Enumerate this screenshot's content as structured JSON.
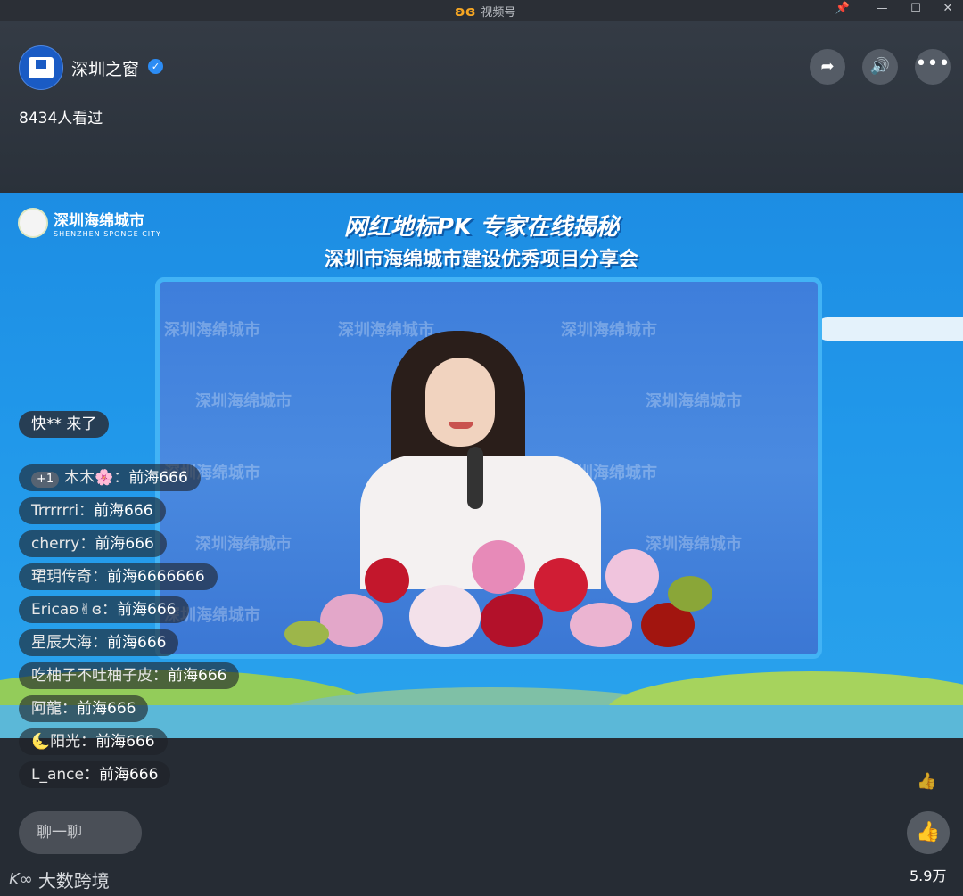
{
  "window": {
    "app_title": "视频号",
    "logo_icon": "butterfly-icon",
    "pin": "📌",
    "minimize": "—",
    "maximize": "☐",
    "close": "✕"
  },
  "channel": {
    "name": "深圳之窗",
    "viewers": "8434人看过"
  },
  "video": {
    "brand_name": "深圳海绵城市",
    "brand_sub": "SHENZHEN SPONGE CITY",
    "banner_line1": "网红地标PK 专家在线揭秘",
    "banner_line2": "深圳市海绵城市建设优秀项目分享会",
    "watermark": "深圳海绵城市"
  },
  "join_message": "快** 来了",
  "comments": [
    {
      "badge": "+1",
      "user": "木木🌸：",
      "msg": "前海666"
    },
    {
      "user": "Trrrrrri：",
      "msg": "前海666"
    },
    {
      "user": "cherry：",
      "msg": "前海666"
    },
    {
      "user": "珺玥传奇：",
      "msg": "前海6666666"
    },
    {
      "user": "Ericaʚ✌ɞ：",
      "msg": "前海666"
    },
    {
      "user": "星辰大海：",
      "msg": "前海666"
    },
    {
      "user": "吃柚子不吐柚子皮：",
      "msg": "前海666"
    },
    {
      "user": "阿龍：",
      "msg": "前海666"
    },
    {
      "user": "🌜阳光：",
      "msg": "前海666"
    },
    {
      "user": "L_ance：",
      "msg": "前海666"
    }
  ],
  "chat_placeholder": "聊一聊",
  "likes": "5.9万",
  "watermark_bottom": "大数跨境"
}
